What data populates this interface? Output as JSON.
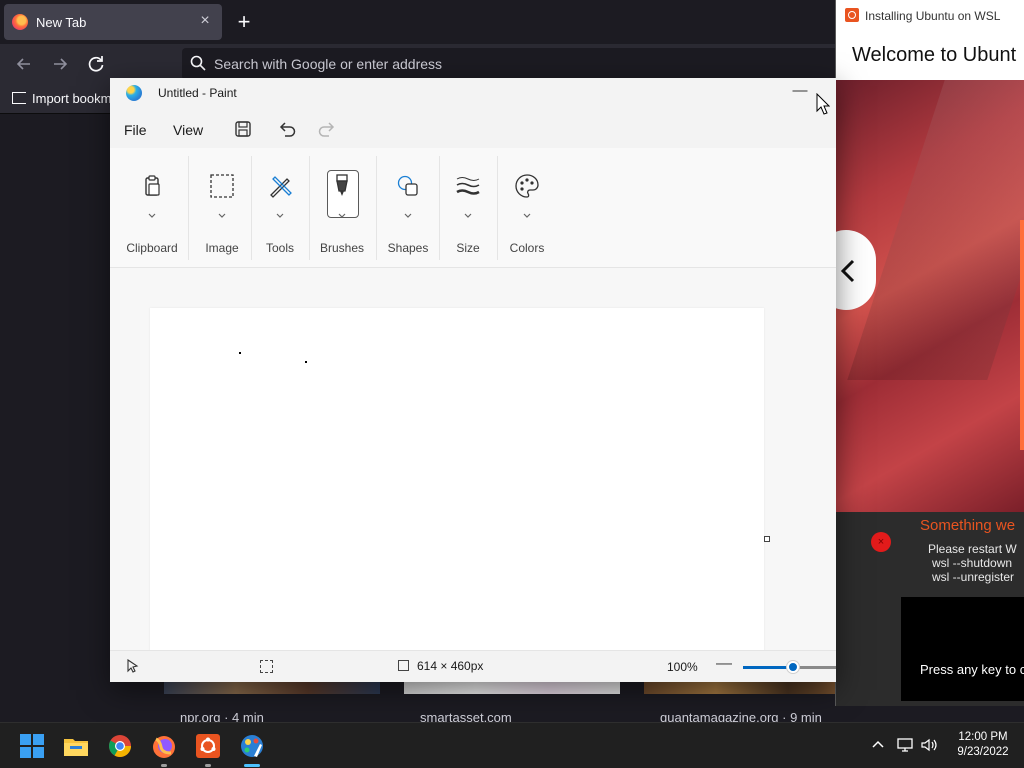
{
  "firefox": {
    "tab_title": "New Tab",
    "tab_close": "×",
    "new_tab": "+",
    "url_placeholder": "Search with Google or enter address",
    "bookmark_import": "Import bookm",
    "stories": [
      {
        "source": "npr.org · 4 min"
      },
      {
        "source": "smartasset.com"
      },
      {
        "source": "quantamagazine.org · 9 min"
      }
    ]
  },
  "ubuntu": {
    "window_title": "Installing Ubuntu on WSL",
    "heading": "Welcome to Ubunt",
    "error_title": "Something we",
    "error_lines": [
      "Please restart W",
      "wsl --shutdown",
      "wsl --unregister"
    ],
    "terminal_prompt": "Press any key to c",
    "accent": "#e95420"
  },
  "paint": {
    "window_title": "Untitled - Paint",
    "minimize": "—",
    "menu": {
      "file": "File",
      "view": "View"
    },
    "ribbon": {
      "clipboard": "Clipboard",
      "image": "Image",
      "tools": "Tools",
      "brushes": "Brushes",
      "shapes": "Shapes",
      "size": "Size",
      "colors": "Colors"
    },
    "status": {
      "canvas_size": "614 × 460px",
      "zoom": "100%",
      "zoom_out": "—"
    },
    "accent": "#0067c0"
  },
  "taskbar": {
    "apps": [
      "start",
      "file-explorer",
      "chrome",
      "firefox",
      "ubuntu",
      "paint"
    ],
    "active_app": "paint",
    "time": "12:00 PM",
    "date": "9/23/2022"
  }
}
